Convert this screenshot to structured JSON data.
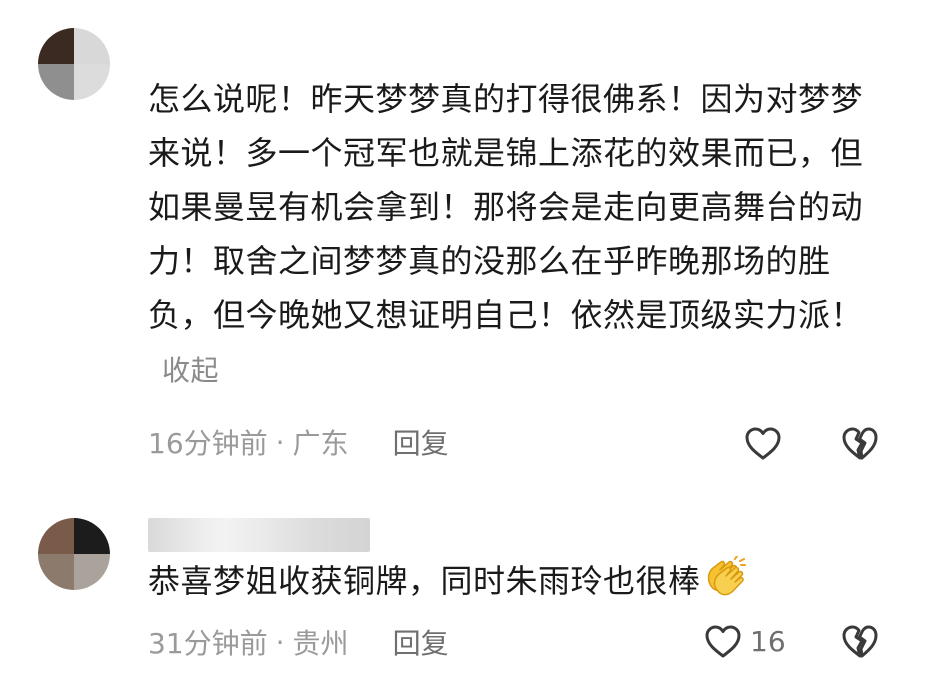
{
  "comments": [
    {
      "text": "怎么说呢！昨天梦梦真的打得很佛系！因为对梦梦来说！多一个冠军也就是锦上添花的效果而已，但如果曼昱有机会拿到！那将会是走向更高舞台的动力！取舍之间梦梦真的没那么在乎昨晚那场的胜负，但今晚她又想证明自己！依然是顶级实力派！",
      "collapse_label": "收起",
      "time": "16分钟前",
      "location": "广东",
      "reply_label": "回复",
      "like_icon": "heart-outline-icon",
      "dislike_icon": "broken-heart-icon",
      "avatar_colors": [
        "#3a2a22",
        "#d8d8d8",
        "#8f8f8f",
        "#dcdcdc"
      ]
    },
    {
      "text": "恭喜梦姐收获铜牌，同时朱雨玲也很棒",
      "emoji": "clapping-hands-emoji",
      "time": "31分钟前",
      "location": "贵州",
      "reply_label": "回复",
      "like_count": "16",
      "like_icon": "heart-outline-icon",
      "dislike_icon": "broken-heart-icon",
      "avatar_colors": [
        "#7a5a48",
        "#1c1c1c",
        "#8c7a6c",
        "#aaa39c"
      ]
    }
  ],
  "separator": "·",
  "colors": {
    "text": "#1a1a1a",
    "meta": "#9a9a9a",
    "action": "#6f6f6f",
    "emoji": "#f6c232"
  }
}
